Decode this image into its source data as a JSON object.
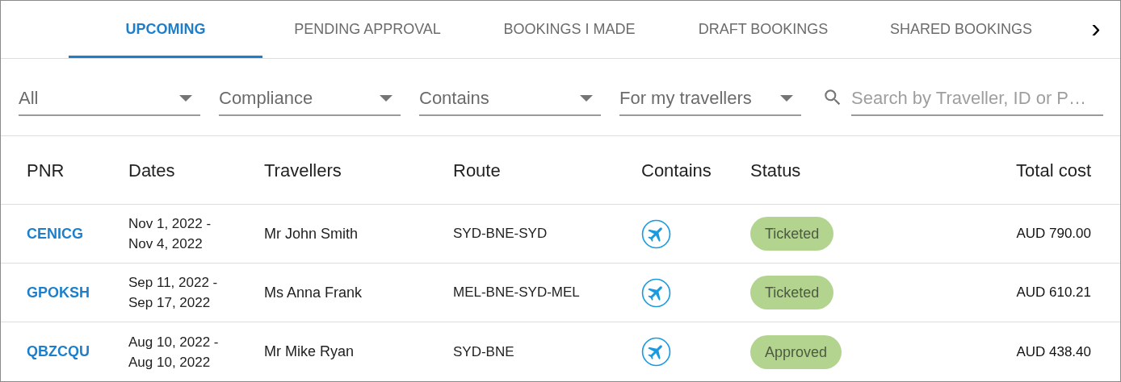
{
  "tabs": [
    {
      "label": "UPCOMING",
      "selected": true
    },
    {
      "label": "PENDING APPROVAL",
      "selected": false
    },
    {
      "label": "BOOKINGS I MADE",
      "selected": false
    },
    {
      "label": "DRAFT BOOKINGS",
      "selected": false
    },
    {
      "label": "SHARED BOOKINGS",
      "selected": false
    }
  ],
  "tab_scroll": {
    "label": "›"
  },
  "filters": [
    {
      "value": "All"
    },
    {
      "value": "Compliance"
    },
    {
      "value": "Contains"
    },
    {
      "value": "For my travellers"
    }
  ],
  "search": {
    "placeholder": "Search by Traveller, ID or P…"
  },
  "table": {
    "columns": [
      "PNR",
      "Dates",
      "Travellers",
      "Route",
      "Contains",
      "Status",
      "Total cost"
    ],
    "rows": [
      {
        "pnr": "CENICG",
        "dates": "Nov 1, 2022 -\nNov 4, 2022",
        "travellers": "Mr John Smith",
        "route": "SYD-BNE-SYD",
        "status": "Ticketed",
        "total_cost": "AUD 790.00"
      },
      {
        "pnr": "GPOKSH",
        "dates": "Sep 11, 2022 -\nSep 17, 2022",
        "travellers": "Ms Anna Frank",
        "route": "MEL-BNE-SYD-MEL",
        "status": "Ticketed",
        "total_cost": "AUD 610.21"
      },
      {
        "pnr": "QBZCQU",
        "dates": "Aug 10, 2022 -\nAug 10, 2022",
        "travellers": "Mr Mike Ryan",
        "route": "SYD-BNE",
        "status": "Approved",
        "total_cost": "AUD 438.40"
      }
    ]
  }
}
